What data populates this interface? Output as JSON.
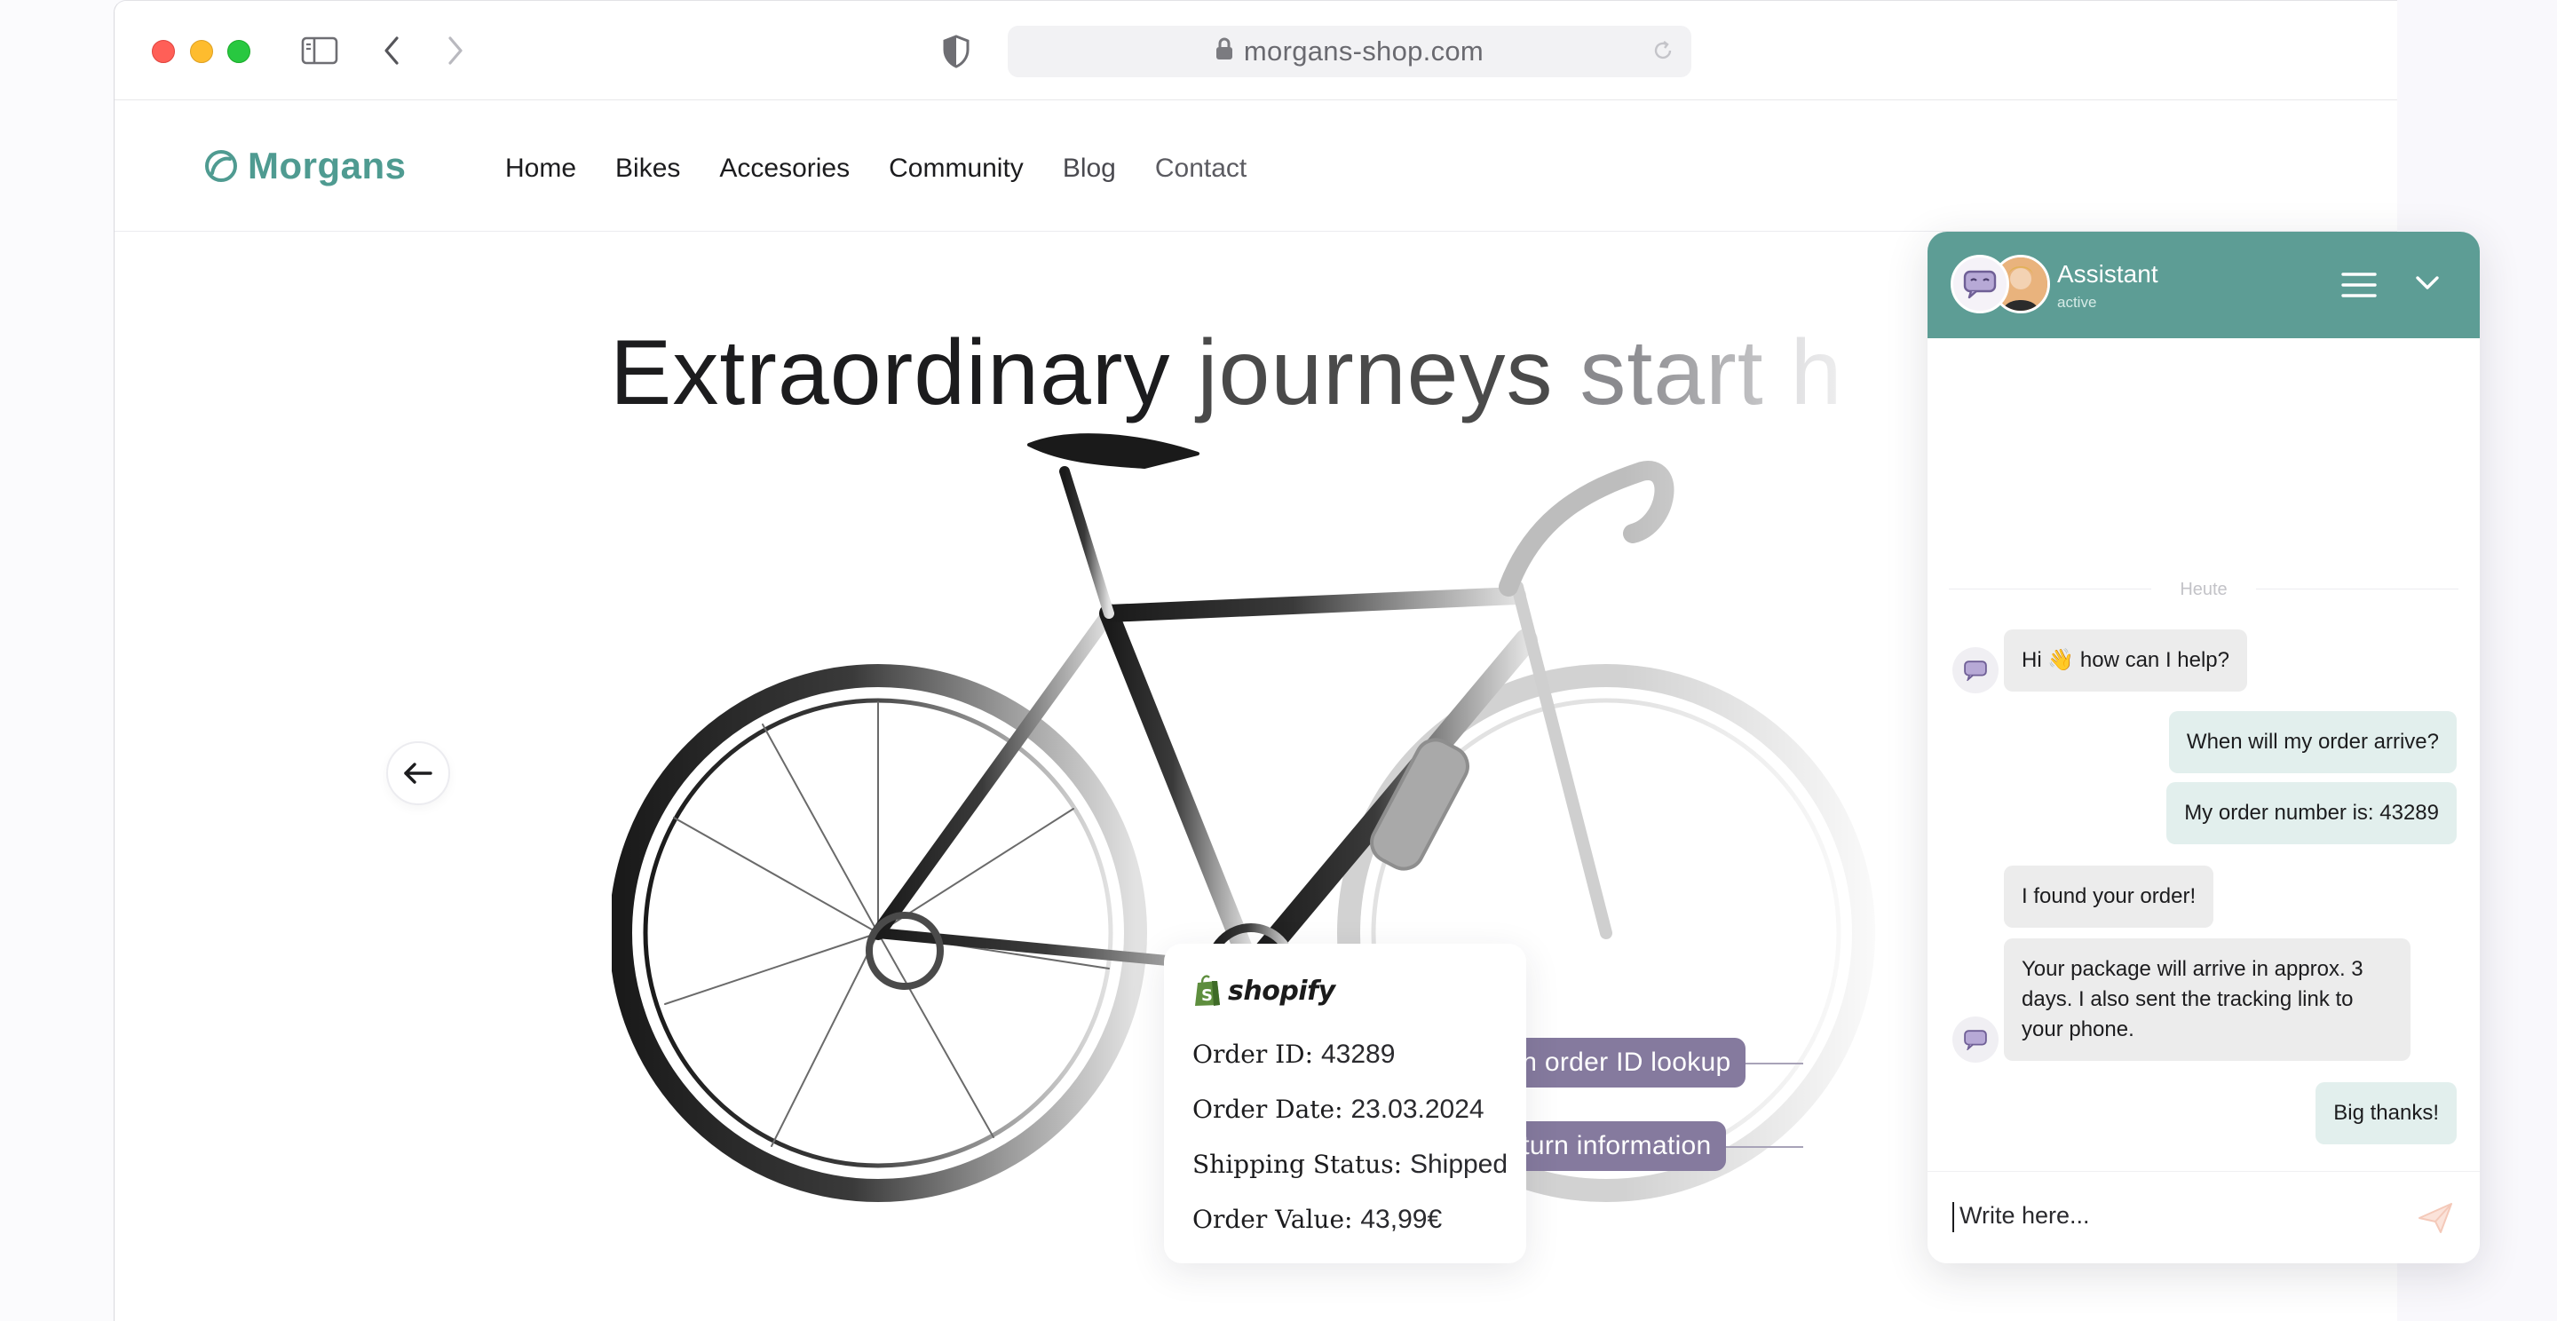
{
  "browser": {
    "url": "morgans-shop.com"
  },
  "site": {
    "logo": "Morgans",
    "nav": [
      "Home",
      "Bikes",
      "Accesories",
      "Community",
      "Blog",
      "Contact"
    ],
    "hero": {
      "word1": "Extraordinary",
      "word2": "journeys",
      "word3": "start",
      "word4": "h"
    }
  },
  "order_card": {
    "brand": "shopify",
    "order_id_label": "Order ID:",
    "order_id": "43289",
    "order_date_label": "Order Date:",
    "order_date": "23.03.2024",
    "shipping_status_label": "Shipping Status:",
    "shipping_status": "Shipped",
    "order_value_label": "Order Value:",
    "order_value": "43,99€"
  },
  "actions": {
    "lookup": "run order ID lookup",
    "return": "return information"
  },
  "chat": {
    "title": "Assistant",
    "status": "active",
    "day": "Heute",
    "messages": [
      {
        "from": "bot",
        "text": "Hi 👋 how can I help?"
      },
      {
        "from": "user",
        "text": "When will my order arrive?"
      },
      {
        "from": "user",
        "text": "My order number is: 43289"
      },
      {
        "from": "bot",
        "text": "I found your order!"
      },
      {
        "from": "bot",
        "text": "Your package will arrive in approx. 3 days. I also sent the tracking link to your phone."
      },
      {
        "from": "user",
        "text": "Big thanks!"
      }
    ],
    "input_placeholder": "Write here..."
  },
  "colors": {
    "brand_teal": "#5d9d95",
    "pill_purple": "#857a9e",
    "bot_bubble": "#ececec",
    "user_bubble": "#e2efed"
  },
  "icons": {
    "sidebar": "sidebar-icon",
    "back": "chevron-left-icon",
    "forward": "chevron-right-icon",
    "shield": "shield-icon",
    "lock": "lock-icon",
    "reload": "reload-icon",
    "menu": "hamburger-icon",
    "collapse": "chevron-down-icon",
    "send": "send-icon",
    "carousel_prev": "arrow-left-icon"
  }
}
